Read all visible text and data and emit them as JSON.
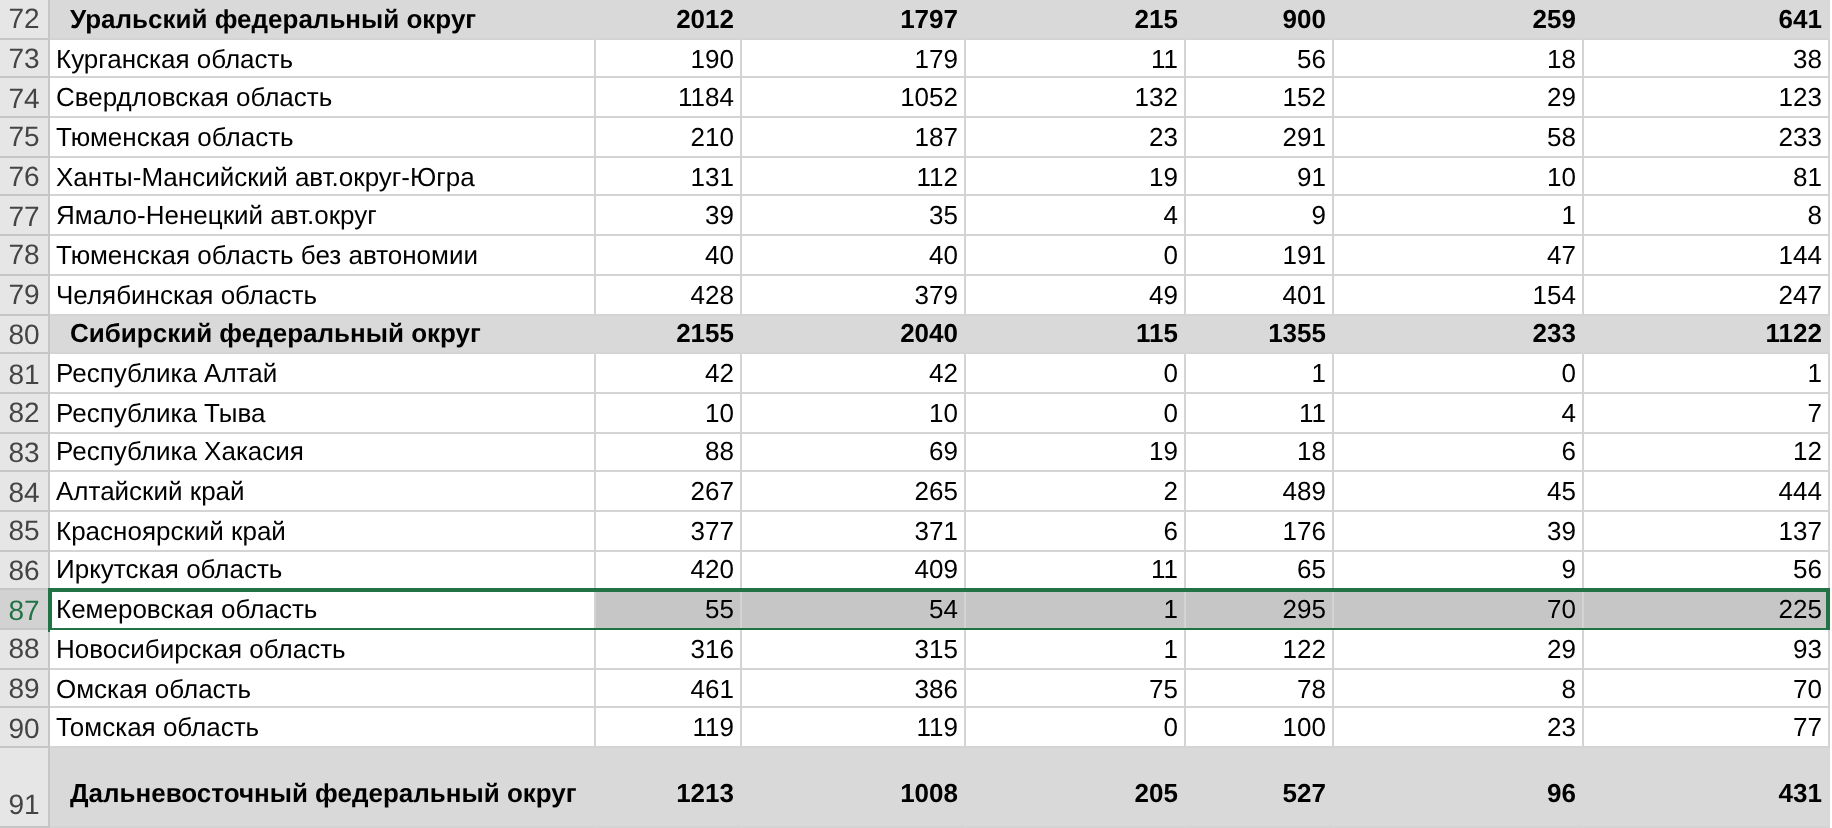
{
  "rows": [
    {
      "number": "72",
      "kind": "district",
      "selected": false,
      "name": "Уральский федеральный округ",
      "values": [
        "2012",
        "1797",
        "215",
        "900",
        "259",
        "641"
      ]
    },
    {
      "number": "73",
      "kind": "region",
      "selected": false,
      "name": "Курганская область",
      "values": [
        "190",
        "179",
        "11",
        "56",
        "18",
        "38"
      ]
    },
    {
      "number": "74",
      "kind": "region",
      "selected": false,
      "name": "Свердловская область",
      "values": [
        "1184",
        "1052",
        "132",
        "152",
        "29",
        "123"
      ]
    },
    {
      "number": "75",
      "kind": "region",
      "selected": false,
      "name": "Тюменская область",
      "values": [
        "210",
        "187",
        "23",
        "291",
        "58",
        "233"
      ]
    },
    {
      "number": "76",
      "kind": "region",
      "selected": false,
      "name": "Ханты-Мансийский авт.округ-Югра",
      "values": [
        "131",
        "112",
        "19",
        "91",
        "10",
        "81"
      ]
    },
    {
      "number": "77",
      "kind": "region",
      "selected": false,
      "name": "Ямало-Ненецкий авт.округ",
      "values": [
        "39",
        "35",
        "4",
        "9",
        "1",
        "8"
      ]
    },
    {
      "number": "78",
      "kind": "region",
      "selected": false,
      "name": "Тюменская область без автономии",
      "values": [
        "40",
        "40",
        "0",
        "191",
        "47",
        "144"
      ]
    },
    {
      "number": "79",
      "kind": "region",
      "selected": false,
      "name": "Челябинская область",
      "values": [
        "428",
        "379",
        "49",
        "401",
        "154",
        "247"
      ]
    },
    {
      "number": "80",
      "kind": "district",
      "selected": false,
      "name": "Сибирский федеральный округ",
      "values": [
        "2155",
        "2040",
        "115",
        "1355",
        "233",
        "1122"
      ]
    },
    {
      "number": "81",
      "kind": "region",
      "selected": false,
      "name": "Республика Алтай",
      "values": [
        "42",
        "42",
        "0",
        "1",
        "0",
        "1"
      ]
    },
    {
      "number": "82",
      "kind": "region",
      "selected": false,
      "name": "Республика Тыва",
      "values": [
        "10",
        "10",
        "0",
        "11",
        "4",
        "7"
      ]
    },
    {
      "number": "83",
      "kind": "region",
      "selected": false,
      "name": "Республика Хакасия",
      "values": [
        "88",
        "69",
        "19",
        "18",
        "6",
        "12"
      ]
    },
    {
      "number": "84",
      "kind": "region",
      "selected": false,
      "name": "Алтайский край",
      "values": [
        "267",
        "265",
        "2",
        "489",
        "45",
        "444"
      ]
    },
    {
      "number": "85",
      "kind": "region",
      "selected": false,
      "name": "Красноярский край",
      "values": [
        "377",
        "371",
        "6",
        "176",
        "39",
        "137"
      ]
    },
    {
      "number": "86",
      "kind": "region",
      "selected": false,
      "name": "Иркутская область",
      "values": [
        "420",
        "409",
        "11",
        "65",
        "9",
        "56"
      ]
    },
    {
      "number": "87",
      "kind": "region",
      "selected": true,
      "name": "Кемеровская область",
      "values": [
        "55",
        "54",
        "1",
        "295",
        "70",
        "225"
      ]
    },
    {
      "number": "88",
      "kind": "region",
      "selected": false,
      "name": "Новосибирская область",
      "values": [
        "316",
        "315",
        "1",
        "122",
        "29",
        "93"
      ]
    },
    {
      "number": "89",
      "kind": "region",
      "selected": false,
      "name": "Омская область",
      "values": [
        "461",
        "386",
        "75",
        "78",
        "8",
        "70"
      ]
    },
    {
      "number": "90",
      "kind": "region",
      "selected": false,
      "name": "Томская область",
      "values": [
        "119",
        "119",
        "0",
        "100",
        "23",
        "77"
      ]
    },
    {
      "number": "91",
      "kind": "district_tall",
      "selected": false,
      "name": "Дальневосточный федеральный округ",
      "values": [
        "1213",
        "1008",
        "205",
        "527",
        "96",
        "431"
      ]
    }
  ]
}
